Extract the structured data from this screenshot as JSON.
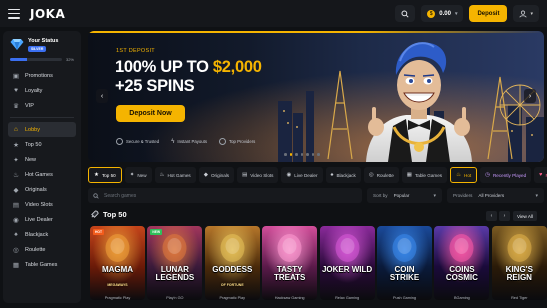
{
  "header": {
    "logo": "JOKA",
    "balance": "0.00",
    "deposit_label": "Deposit"
  },
  "sidebar": {
    "status_title": "Your Status",
    "status_badge": "SILVER",
    "progress_pct": "32%",
    "progress_value": 32,
    "items_top": [
      {
        "label": "Promotions",
        "icon": "gift-icon"
      },
      {
        "label": "Loyalty",
        "icon": "heart-icon"
      },
      {
        "label": "VIP",
        "icon": "crown-icon"
      }
    ],
    "items": [
      {
        "label": "Lobby",
        "icon": "home-icon",
        "active": true
      },
      {
        "label": "Top 50",
        "icon": "star-icon"
      },
      {
        "label": "New",
        "icon": "sparkle-icon"
      },
      {
        "label": "Hot Games",
        "icon": "flame-icon"
      },
      {
        "label": "Originals",
        "icon": "diamond-icon"
      },
      {
        "label": "Video Slots",
        "icon": "slot-icon"
      },
      {
        "label": "Live Dealer",
        "icon": "dealer-icon"
      },
      {
        "label": "Blackjack",
        "icon": "cards-icon"
      },
      {
        "label": "Roulette",
        "icon": "roulette-icon"
      },
      {
        "label": "Table Games",
        "icon": "table-icon"
      }
    ]
  },
  "hero": {
    "kicker": "1ST DEPOSIT",
    "line1_pre": "100% UP TO ",
    "line1_amount": "$2,000",
    "line2": "+25 SPINS",
    "cta": "Deposit Now",
    "trust": [
      "Secure & Trusted",
      "Instant Payouts",
      "Top Providers"
    ],
    "slides": 7,
    "active_slide": 1
  },
  "tabs": [
    {
      "label": "Top 50",
      "icon": "star-icon",
      "state": "active"
    },
    {
      "label": "New",
      "icon": "sparkle-icon"
    },
    {
      "label": "Hot Games",
      "icon": "flame-icon"
    },
    {
      "label": "Originals",
      "icon": "diamond-icon"
    },
    {
      "label": "Video Slots",
      "icon": "slot-icon"
    },
    {
      "label": "Live Dealer",
      "icon": "dealer-icon"
    },
    {
      "label": "Blackjack",
      "icon": "cards-icon"
    },
    {
      "label": "Roulette",
      "icon": "roulette-icon"
    },
    {
      "label": "Table Games",
      "icon": "table-icon"
    },
    {
      "label": "Hot",
      "icon": "flame-icon",
      "state": "hot"
    },
    {
      "label": "Recently Played",
      "icon": "clock-icon",
      "state": "recent"
    },
    {
      "label": "Favourites",
      "icon": "heart-icon",
      "state": "fav"
    }
  ],
  "search": {
    "placeholder": "Search games",
    "sort_label": "Sort by",
    "sort_value": "Popular",
    "providers_label": "Providers",
    "providers_value": "All Providers"
  },
  "section": {
    "title": "Top 50",
    "view_all": "View All"
  },
  "games": [
    {
      "name": "MAGMA",
      "sub": "MEGAWAYS",
      "provider": "Pragmatic Play",
      "badge": "HOT",
      "colors": [
        "#6a1a08",
        "#c5451a",
        "#f0a23a"
      ]
    },
    {
      "name": "LUNAR LEGENDS",
      "sub": "",
      "provider": "Play'n GO",
      "badge": "NEW",
      "colors": [
        "#3a1a3a",
        "#a2365c",
        "#e07a3c"
      ]
    },
    {
      "name": "GODDESS",
      "sub": "OF FORTUNE",
      "provider": "Pragmatic Play",
      "badge": "",
      "colors": [
        "#4a2a0a",
        "#b6772a",
        "#e8c25a"
      ]
    },
    {
      "name": "TASTY TREATS",
      "sub": "",
      "provider": "Hacksaw Gaming",
      "badge": "",
      "colors": [
        "#5a1a4a",
        "#d24e9a",
        "#ff9ad2"
      ]
    },
    {
      "name": "JOKER WILD",
      "sub": "",
      "provider": "Relax Gaming",
      "badge": "",
      "colors": [
        "#2a0a3a",
        "#8a2a9a",
        "#d85ad8"
      ]
    },
    {
      "name": "COIN STRIKE",
      "sub": "",
      "provider": "Push Gaming",
      "badge": "",
      "colors": [
        "#0a1a3a",
        "#1a4a9a",
        "#3a8aee"
      ]
    },
    {
      "name": "COINS COSMIC",
      "sub": "",
      "provider": "BGaming",
      "badge": "",
      "colors": [
        "#1a0a3a",
        "#5a3aa8",
        "#ff5aa8"
      ]
    },
    {
      "name": "KING'S REIGN",
      "sub": "",
      "provider": "Red Tiger",
      "badge": "",
      "colors": [
        "#2a1a08",
        "#7a5a22",
        "#e2b24a"
      ]
    }
  ]
}
